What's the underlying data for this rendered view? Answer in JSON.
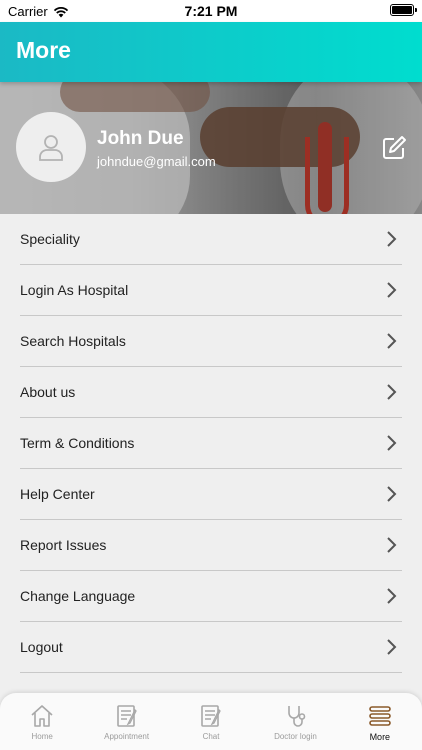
{
  "status_bar": {
    "carrier": "Carrier",
    "time": "7:21 PM"
  },
  "header": {
    "title": "More"
  },
  "profile": {
    "name": "John Due",
    "email": "johndue@gmail.com"
  },
  "menu": {
    "items": [
      {
        "label": "Speciality"
      },
      {
        "label": "Login As Hospital"
      },
      {
        "label": "Search Hospitals"
      },
      {
        "label": "About us"
      },
      {
        "label": "Term & Conditions"
      },
      {
        "label": "Help Center"
      },
      {
        "label": "Report Issues"
      },
      {
        "label": "Change Language"
      },
      {
        "label": "Logout"
      }
    ]
  },
  "tabbar": {
    "tabs": [
      {
        "label": "Home",
        "icon": "home-icon"
      },
      {
        "label": "Appointment",
        "icon": "appointment-icon"
      },
      {
        "label": "Chat",
        "icon": "chat-icon"
      },
      {
        "label": "Doctor login",
        "icon": "stethoscope-icon"
      },
      {
        "label": "More",
        "icon": "menu-icon"
      }
    ],
    "active": "More"
  },
  "colors": {
    "accent_start": "#1bb9c5",
    "accent_end": "#00ddcf",
    "active_tab_icon": "#8a5a2b"
  }
}
